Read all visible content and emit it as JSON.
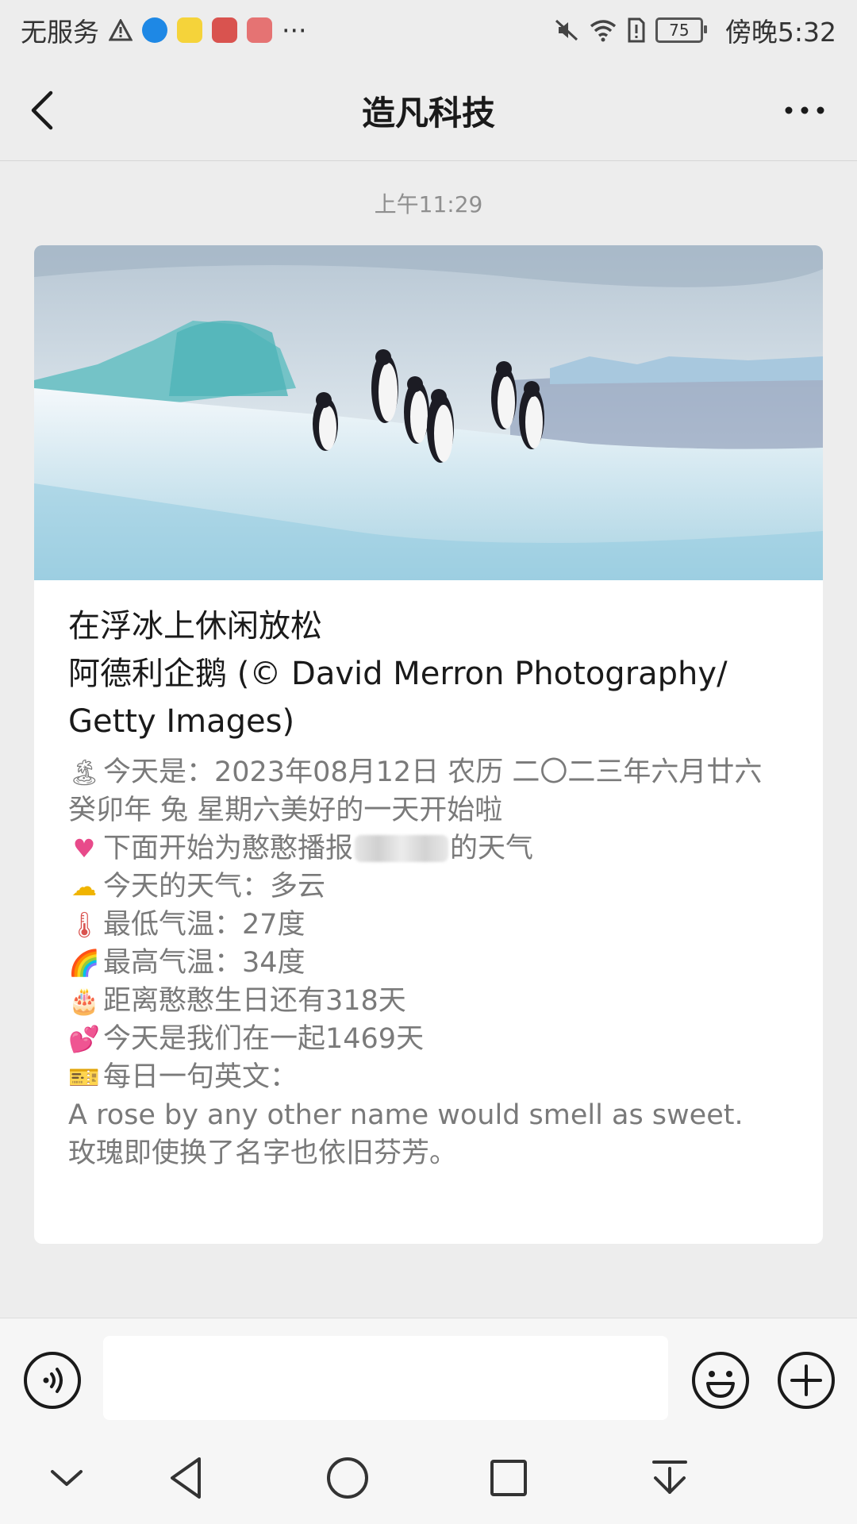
{
  "status_bar": {
    "carrier": "无服务",
    "overflow": "···",
    "battery": "75",
    "time": "傍晚5:32"
  },
  "header": {
    "title": "造凡科技"
  },
  "chat": {
    "timestamp": "上午11:29",
    "card": {
      "image_alt": "penguins-on-ice-photo",
      "title_lines": [
        "在浮冰上休闲放松",
        "阿德利企鹅 (© David Merron Photography/",
        "Getty Images)"
      ],
      "today_label": "今天是：2023年08月12日 农历 二〇二三年六月廿六 癸卯年 兔 星期六美好的一天开始啦",
      "broadcast_prefix": "下面开始为憨憨播报",
      "broadcast_suffix": "的天气",
      "weather": "今天的天气：多云",
      "low_temp": "最低气温：27度",
      "high_temp": "最高气温：34度",
      "birthday": "距离憨憨生日还有318天",
      "together": "今天是我们在一起1469天",
      "english_label": "每日一句英文：",
      "english_sentence": "A rose by any other name would smell as sweet.",
      "chinese_sentence": "玫瑰即使换了名字也依旧芬芳。"
    }
  },
  "input": {
    "placeholder": ""
  },
  "icons": {
    "back": "back-arrow-icon",
    "more": "more-icon",
    "voice": "voice-icon",
    "emoji": "emoji-icon",
    "plus": "plus-icon"
  }
}
